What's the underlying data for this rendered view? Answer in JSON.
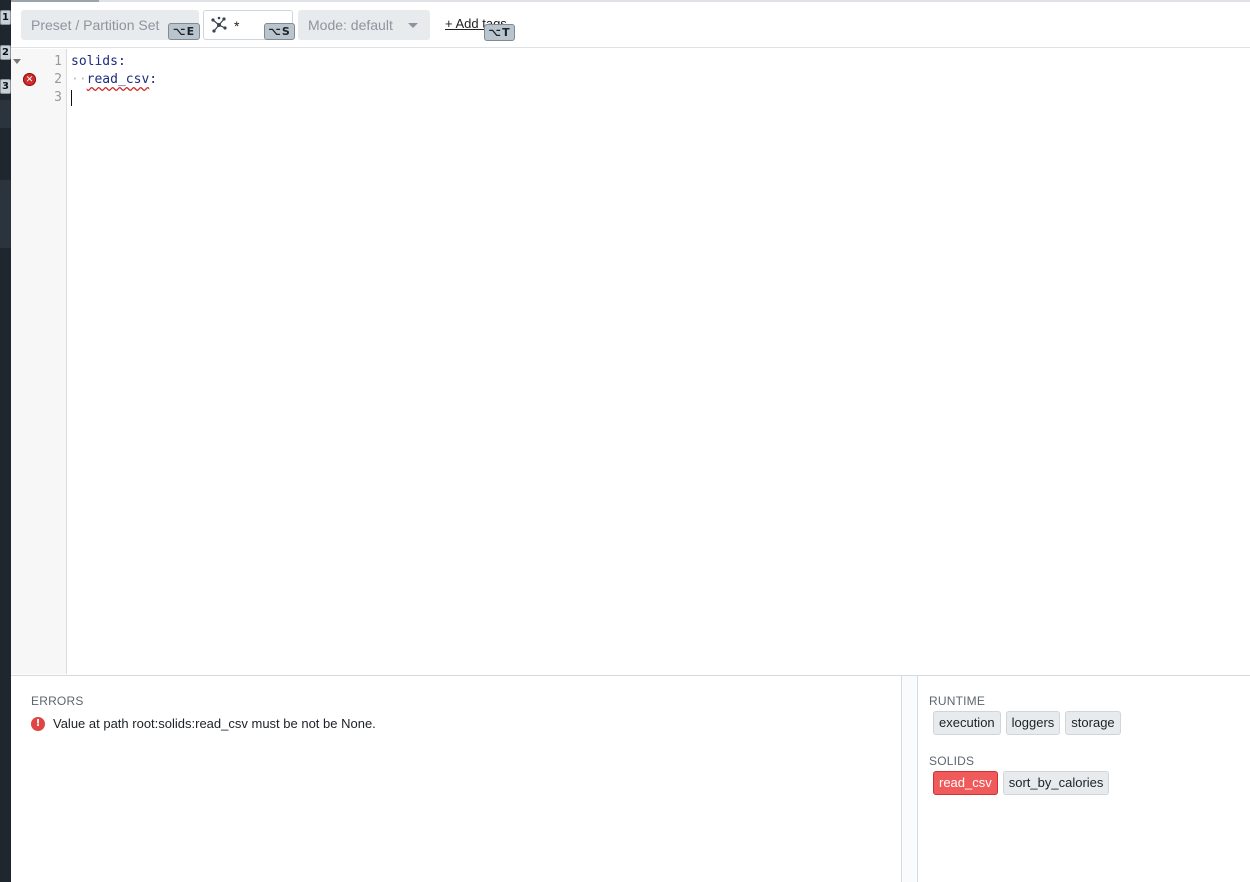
{
  "rail": {
    "hints": [
      "1",
      "2",
      "3"
    ]
  },
  "toolbar": {
    "preset_label": "Preset / Partition Set",
    "preset_shortcut": "⌥E",
    "selector_value": "*",
    "selector_shortcut": "⌥S",
    "mode_label": "Mode: default",
    "add_tags_label": "+ Add tags",
    "add_tags_shortcut": "⌥T"
  },
  "editor": {
    "lines": [
      {
        "number": "1",
        "text": "solids:"
      },
      {
        "number": "2",
        "indent": "··",
        "text": "read_csv",
        "suffix": ":"
      },
      {
        "number": "3",
        "text": ""
      }
    ],
    "error_line": "2"
  },
  "errors_panel": {
    "title": "ERRORS",
    "items": [
      "Value at path root:solids:read_csv must be not be None."
    ]
  },
  "runtime_panel": {
    "title": "RUNTIME",
    "chips": [
      "execution",
      "loggers",
      "storage"
    ]
  },
  "solids_panel": {
    "title": "SOLIDS",
    "chips": [
      {
        "label": "read_csv",
        "status": "error"
      },
      {
        "label": "sort_by_calories",
        "status": "ok"
      }
    ]
  },
  "colors": {
    "error": "#f05a5a",
    "accent": "#1d2b7a"
  }
}
